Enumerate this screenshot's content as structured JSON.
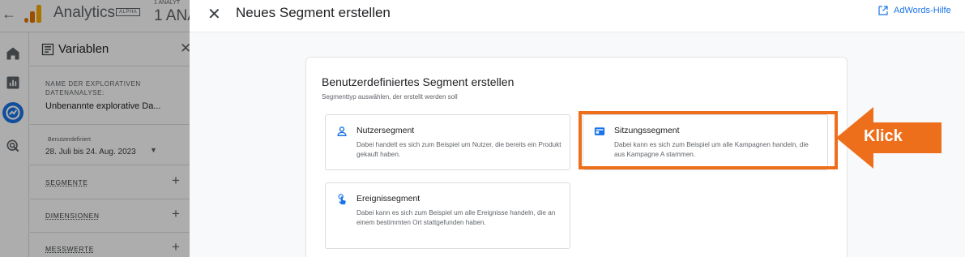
{
  "app": {
    "title": "Analytics",
    "badge": "ALPHA",
    "account_small": "1 ANALYT",
    "account_big": "1 ANA"
  },
  "variables_panel": {
    "title": "Variablen",
    "exploration_label": "NAME DER EXPLORATIVEN DATENANALYSE:",
    "exploration_value": "Unbenannte explorative Da...",
    "date_label": "Benutzerdefiniert",
    "date_value": "28. Juli bis 24. Aug. 2023",
    "sections": [
      {
        "label": "SEGMENTE"
      },
      {
        "label": "DIMENSIONEN"
      },
      {
        "label": "MESSWERTE"
      }
    ]
  },
  "dialog": {
    "title": "Neues Segment erstellen",
    "help_link": "AdWords-Hilfe",
    "card_title": "Benutzerdefiniertes Segment erstellen",
    "card_subtitle": "Segmenttyp auswählen, der erstellt werden soll",
    "options": [
      {
        "title": "Nutzersegment",
        "description": "Dabei handelt es sich zum Beispiel um Nutzer, die bereits ein Produkt gekauft haben.",
        "icon": "person-icon"
      },
      {
        "title": "Sitzungssegment",
        "description": "Dabei kann es sich zum Beispiel um alle Kampagnen handeln, die aus Kampagne A stammen.",
        "icon": "session-icon"
      },
      {
        "title": "Ereignissegment",
        "description": "Dabei kann es sich zum Beispiel um alle Ereignisse handeln, die an einem bestimmten Ort stattgefunden haben.",
        "icon": "tap-icon"
      }
    ]
  },
  "annotation": {
    "label": "Klick",
    "color": "#ee6f1b"
  },
  "colors": {
    "accent": "#1a73e8",
    "annotation": "#ee6f1b",
    "overlay": "rgba(0,0,0,0.32)"
  }
}
